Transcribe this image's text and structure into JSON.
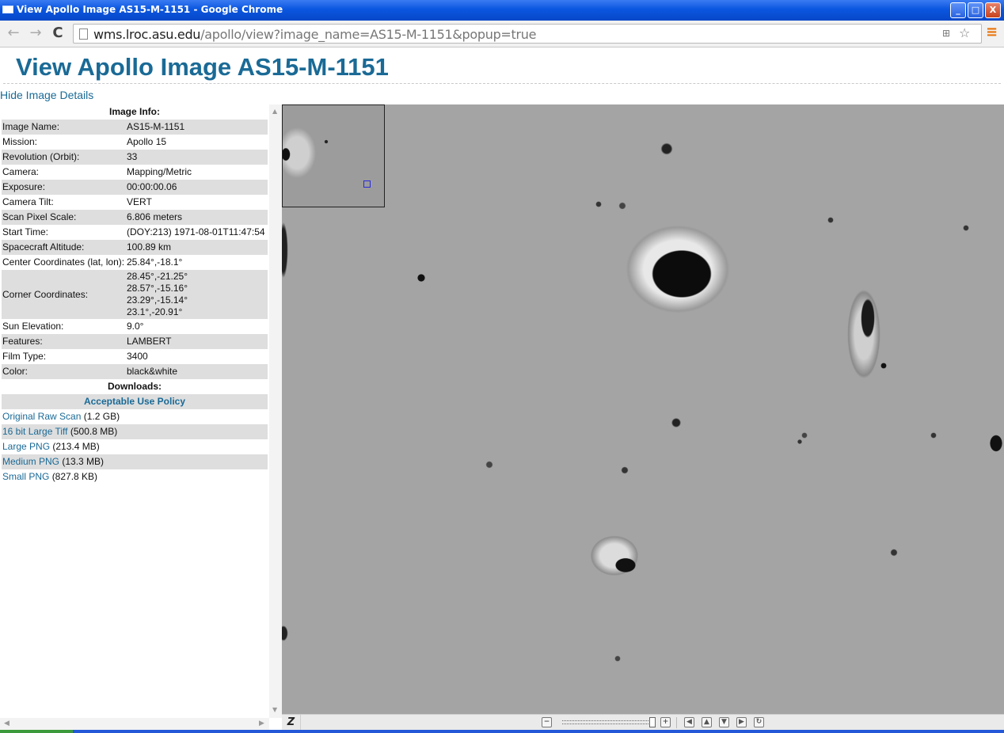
{
  "window": {
    "title": "View Apollo Image AS15-M-1151 - Google Chrome",
    "controls": {
      "minimize": "_",
      "maximize": "□",
      "close": "X"
    }
  },
  "toolbar": {
    "back_icon": "←",
    "forward_icon": "→",
    "reload_icon": "C",
    "url_host": "wms.lroc.asu.edu",
    "url_path": "/apollo/view?image_name=AS15-M-1151&popup=true",
    "translate_icon": "⊞",
    "star_icon": "☆",
    "menu_icon": "≡"
  },
  "page": {
    "title": "View Apollo Image AS15-M-1151",
    "hide_details_link": "Hide Image Details"
  },
  "image_info": {
    "header": "Image Info:",
    "rows": [
      {
        "label": "Image Name:",
        "value": "AS15-M-1151"
      },
      {
        "label": "Mission:",
        "value": "Apollo 15"
      },
      {
        "label": "Revolution (Orbit):",
        "value": "33"
      },
      {
        "label": "Camera:",
        "value": "Mapping/Metric"
      },
      {
        "label": "Exposure:",
        "value": "00:00:00.06"
      },
      {
        "label": "Camera Tilt:",
        "value": "VERT"
      },
      {
        "label": "Scan Pixel Scale:",
        "value": "6.806 meters"
      },
      {
        "label": "Start Time:",
        "value": "(DOY:213) 1971-08-01T11:47:54"
      },
      {
        "label": "Spacecraft Altitude:",
        "value": "100.89 km"
      },
      {
        "label": "Center Coordinates (lat, lon):",
        "value": "25.84°,-18.1°"
      },
      {
        "label": "Corner Coordinates:",
        "value": [
          "28.45°,-21.25°",
          "28.57°,-15.16°",
          "23.29°,-15.14°",
          "23.1°,-20.91°"
        ]
      },
      {
        "label": "Sun Elevation:",
        "value": "9.0°"
      },
      {
        "label": "Features:",
        "value": "LAMBERT"
      },
      {
        "label": "Film Type:",
        "value": "3400"
      },
      {
        "label": "Color:",
        "value": "black&white"
      }
    ]
  },
  "downloads": {
    "header": "Downloads:",
    "policy_link": "Acceptable Use Policy",
    "items": [
      {
        "label": "Original Raw Scan",
        "size": "(1.2 GB)"
      },
      {
        "label": "16 bit Large Tiff",
        "size": "(500.8 MB)"
      },
      {
        "label": "Large PNG",
        "size": "(213.4 MB)"
      },
      {
        "label": "Medium PNG",
        "size": "(13.3 MB)"
      },
      {
        "label": "Small PNG",
        "size": "(827.8 KB)"
      }
    ]
  },
  "viewer": {
    "logo": "Z",
    "zoom_out": "−",
    "zoom_in": "+",
    "pan_left": "◀",
    "pan_up": "▲",
    "pan_down": "▼",
    "pan_right": "▶",
    "reset": "↻"
  },
  "colors": {
    "link": "#1a6a96",
    "title_bar": "#0a56e0",
    "alt_row": "#dedede"
  }
}
